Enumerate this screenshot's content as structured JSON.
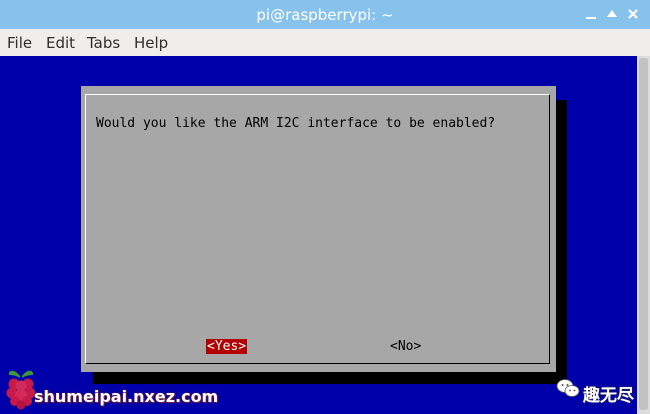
{
  "window": {
    "title": "pi@raspberrypi: ~"
  },
  "menu": {
    "items": [
      "File",
      "Edit",
      "Tabs",
      "Help"
    ]
  },
  "dialog": {
    "prompt": "Would you like the ARM I2C interface to be enabled?",
    "yes_label": "<Yes>",
    "no_label": "<No>",
    "selected": "yes"
  },
  "watermark": {
    "site": "shumeipai.nxez.com",
    "brand": "趣无尽"
  },
  "colors": {
    "terminal_bg": "#0000aa",
    "dialog_bg": "#a7a7a7",
    "selected_button_bg": "#b30000",
    "titlebar_bg": "#87c2ec"
  },
  "icons": {
    "minimize": "minimize-icon",
    "maximize": "maximize-icon",
    "close": "close-icon",
    "watermark_logo": "raspberry-logo-icon",
    "wechat": "wechat-icon"
  }
}
